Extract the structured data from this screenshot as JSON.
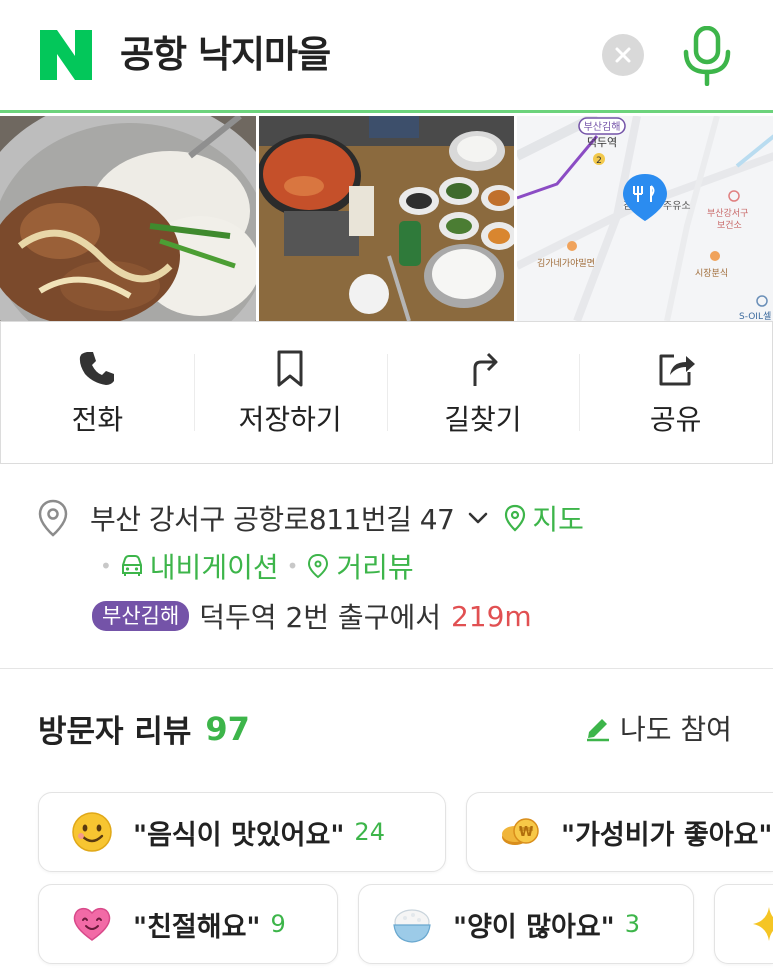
{
  "search": {
    "query": "공항 낙지마을",
    "logo_letter": "N"
  },
  "map": {
    "station_badge_line": "부산김해",
    "station_name": "덕두역",
    "station_number": "2",
    "label_left_partial": "김",
    "label_right_partial": "주유소",
    "label_health": "부산강서구\n보건소",
    "label_restaurant1": "김가네가야밀면",
    "label_restaurant2": "시장분식",
    "label_bottom": "S-OIL셀"
  },
  "actions": [
    {
      "label": "전화",
      "icon": "phone-icon"
    },
    {
      "label": "저장하기",
      "icon": "bookmark-icon"
    },
    {
      "label": "길찾기",
      "icon": "directions-icon"
    },
    {
      "label": "공유",
      "icon": "share-icon"
    }
  ],
  "address": {
    "text": "부산 강서구 공항로811번길 47",
    "map_link": "지도",
    "navigation_link": "내비게이션",
    "street_view_link": "거리뷰",
    "line_badge": "부산김해",
    "station_text": "덕두역 2번 출구에서",
    "distance": "219m"
  },
  "reviews": {
    "title": "방문자 리뷰",
    "count": "97",
    "join_label": "나도 참여",
    "chips": [
      {
        "text": "\"음식이 맛있어요\"",
        "count": "24",
        "icon": "smile-emoji-icon"
      },
      {
        "text": "\"가성비가 좋아요\"",
        "count": "",
        "icon": "coin-emoji-icon"
      },
      {
        "text": "\"친절해요\"",
        "count": "9",
        "icon": "heart-emoji-icon"
      },
      {
        "text": "\"양이 많아요\"",
        "count": "3",
        "icon": "rice-bowl-emoji-icon"
      },
      {
        "text": "",
        "count": "",
        "icon": "sparkle-emoji-icon"
      }
    ]
  },
  "colors": {
    "brand_green": "#03c75a",
    "link_green": "#3db54a",
    "distance_red": "#e15052",
    "subway_purple": "#7453a8",
    "map_pin_blue": "#2b8cf0"
  }
}
